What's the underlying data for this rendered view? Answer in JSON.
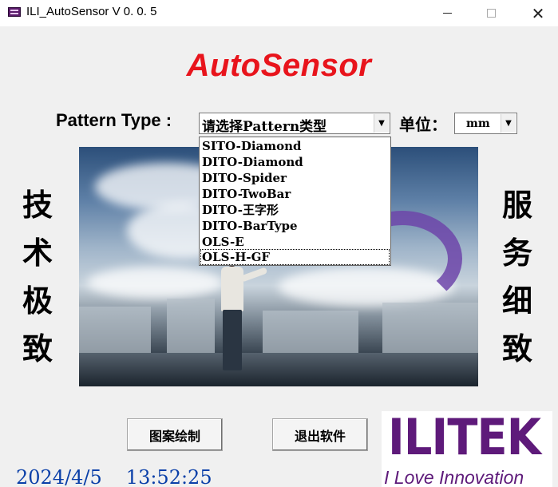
{
  "window": {
    "title": "ILI_AutoSensor V 0. 0. 5",
    "controls": {
      "minimize": "minimize",
      "maximize": "maximize",
      "close": "✕"
    }
  },
  "heading": "AutoSensor",
  "pattern": {
    "label": "Pattern Type :",
    "selected": "请选择Pattern类型",
    "options": [
      "SITO-Diamond",
      "DITO-Diamond",
      "DITO-Spider",
      "DITO-TwoBar",
      "DITO-王字形",
      "DITO-BarType",
      "OLS-E",
      "OLS-H-GF"
    ],
    "highlighted_index": 7
  },
  "unit": {
    "label": "单位：",
    "selected": "mm"
  },
  "slogans": {
    "left": [
      "技",
      "术",
      "极",
      "致"
    ],
    "right": [
      "服",
      "务",
      "细",
      "致"
    ]
  },
  "buttons": {
    "draw": "图案绘制",
    "exit": "退出软件"
  },
  "status": {
    "date": "2024/4/5",
    "time": "13:52:25"
  },
  "logo": {
    "wordmark": "ILITEK",
    "tagline": "I Love Innovation"
  },
  "colors": {
    "heading": "#e8141c",
    "datetime": "#0a3fa8",
    "brand": "#5e1a7a"
  }
}
